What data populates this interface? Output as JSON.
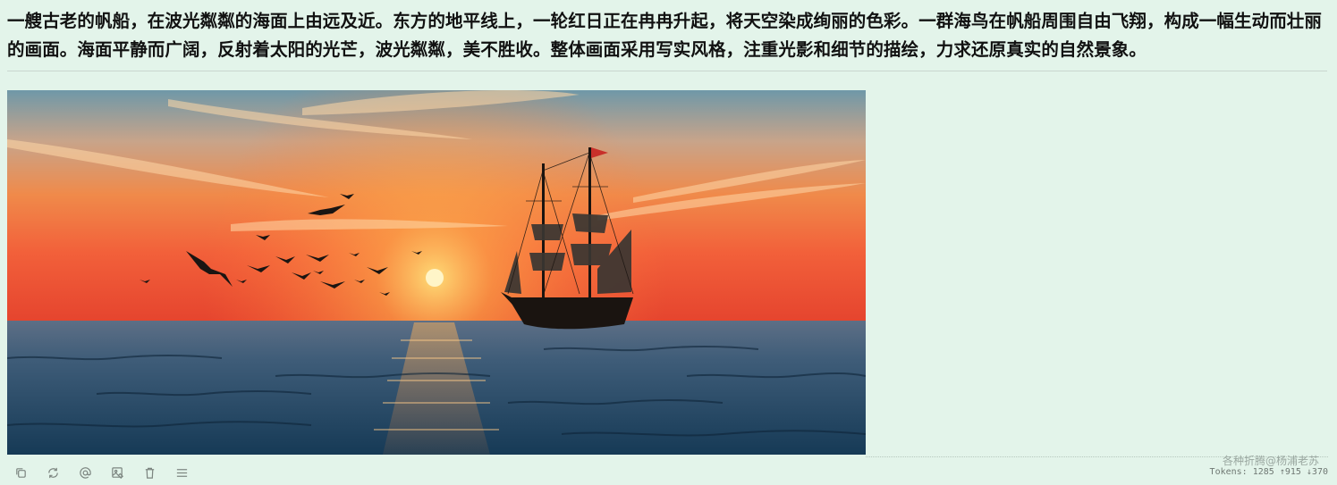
{
  "message": {
    "text": "一艘古老的帆船，在波光粼粼的海面上由远及近。东方的地平线上，一轮红日正在冉冉升起，将天空染成绚丽的色彩。一群海鸟在帆船周围自由飞翔，构成一幅生动而壮丽的画面。海面平静而广阔，反射着太阳的光芒，波光粼粼，美不胜收。整体画面采用写实风格，注重光影和细节的描绘，力求还原真实的自然景象。"
  },
  "toolbar": {
    "icons": [
      "copy-icon",
      "regenerate-icon",
      "mention-icon",
      "image-edit-icon",
      "delete-icon",
      "menu-icon"
    ]
  },
  "footer": {
    "watermark": "各种折腾@杨浦老苏",
    "tokens": "Tokens: 1285 ↑915 ↓370"
  },
  "colors": {
    "background": "#e3f4ea",
    "text": "#111111",
    "icon": "#7c8580"
  }
}
